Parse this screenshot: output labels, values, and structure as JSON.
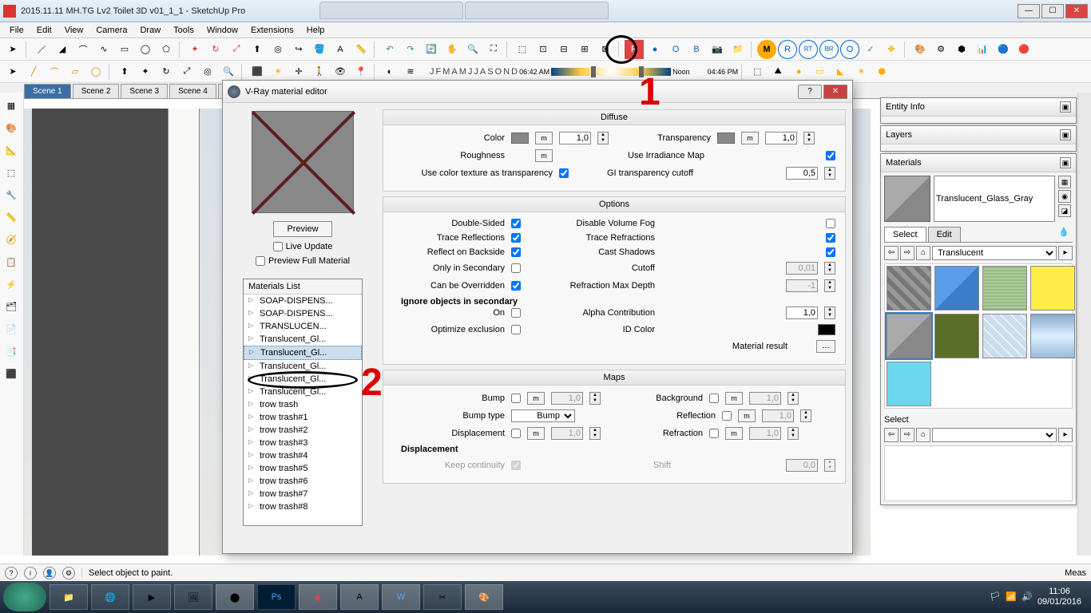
{
  "window": {
    "title": "2015.11.11 MH.TG Lv2 Toilet 3D v01_1_1 - SketchUp Pro",
    "min": "—",
    "max": "☐",
    "close": "✕"
  },
  "menu": [
    "File",
    "Edit",
    "View",
    "Camera",
    "Draw",
    "Tools",
    "Window",
    "Extensions",
    "Help"
  ],
  "scenes": [
    "Scene 1",
    "Scene 2",
    "Scene 3",
    "Scene 4",
    "Sce"
  ],
  "timebar": {
    "months": [
      "J",
      "F",
      "M",
      "A",
      "M",
      "J",
      "J",
      "A",
      "S",
      "O",
      "N",
      "D"
    ],
    "time_left": "06:42 AM",
    "noon": "Noon",
    "time_right": "04:46 PM"
  },
  "dialog": {
    "title": "V-Ray material editor",
    "preview_btn": "Preview",
    "live_update": "Live Update",
    "preview_full": "Preview Full Material",
    "list_header": "Materials List",
    "materials": [
      "SOAP-DISPENS...",
      "SOAP-DISPENS...",
      "TRANSLUCEN...",
      "Translucent_Gl...",
      "Translucent_Gl...",
      "Translucent_Gl...",
      "Translucent_Gl...",
      "Translucent_Gl...",
      "trow trash",
      "trow trash#1",
      "trow trash#2",
      "trow trash#3",
      "trow trash#4",
      "trow trash#5",
      "trow trash#6",
      "trow trash#7",
      "trow trash#8"
    ],
    "selected_mat_index": 4,
    "groups": {
      "diffuse": {
        "header": "Diffuse",
        "color_lbl": "Color",
        "color_val": "1,0",
        "transparency_lbl": "Transparency",
        "transparency_val": "1,0",
        "roughness_lbl": "Roughness",
        "use_irr_lbl": "Use Irradiance Map",
        "use_irr_chk": true,
        "use_tex_trans_lbl": "Use color texture as transparency",
        "use_tex_trans_chk": true,
        "gi_cutoff_lbl": "GI transparency cutoff",
        "gi_cutoff_val": "0,5"
      },
      "options": {
        "header": "Options",
        "double_sided": "Double-Sided",
        "double_sided_chk": true,
        "disable_fog": "Disable Volume Fog",
        "disable_fog_chk": false,
        "trace_refl": "Trace Reflections",
        "trace_refl_chk": true,
        "trace_refr": "Trace Refractions",
        "trace_refr_chk": true,
        "refl_back": "Reflect on Backside",
        "refl_back_chk": true,
        "cast_shadows": "Cast Shadows",
        "cast_shadows_chk": true,
        "only_secondary": "Only in Secondary",
        "only_secondary_chk": false,
        "cutoff": "Cutoff",
        "cutoff_val": "0,01",
        "can_override": "Can be Overridden",
        "can_override_chk": true,
        "refr_depth": "Refraction Max Depth",
        "refr_depth_val": "-1",
        "ignore_secondary": "Ignore objects in secondary",
        "on_lbl": "On",
        "on_chk": false,
        "alpha_contrib": "Alpha Contribution",
        "alpha_val": "1,0",
        "optimize": "Optimize exclusion",
        "optimize_chk": false,
        "id_color": "ID Color",
        "mat_result": "Material result",
        "mat_result_btn": "..."
      },
      "maps": {
        "header": "Maps",
        "bump": "Bump",
        "bump_val": "1,0",
        "background": "Background",
        "bg_val": "1,0",
        "bump_type": "Bump type",
        "bump_type_val": "Bump",
        "reflection": "Reflection",
        "refl_val": "1,0",
        "displacement": "Displacement",
        "disp_val": "1,0",
        "refraction": "Refraction",
        "refr_val": "1,0",
        "disp_header": "Displacement",
        "keep_cont": "Keep continuity",
        "keep_cont_chk": true,
        "shift": "Shift",
        "shift_val": "0,0"
      }
    }
  },
  "panels": {
    "entity": "Entity Info",
    "layers": "Layers",
    "materials": {
      "title": "Materials",
      "name": "Translucent_Glass_Gray",
      "tabs": [
        "Select",
        "Edit"
      ],
      "nav_select": "Translucent",
      "select2": "Select"
    }
  },
  "statusbar": {
    "msg": "Select object to paint.",
    "meas_lbl": "Meas"
  },
  "taskbar": {
    "time": "11:06",
    "date": "09/01/2016"
  },
  "m_label": "m"
}
